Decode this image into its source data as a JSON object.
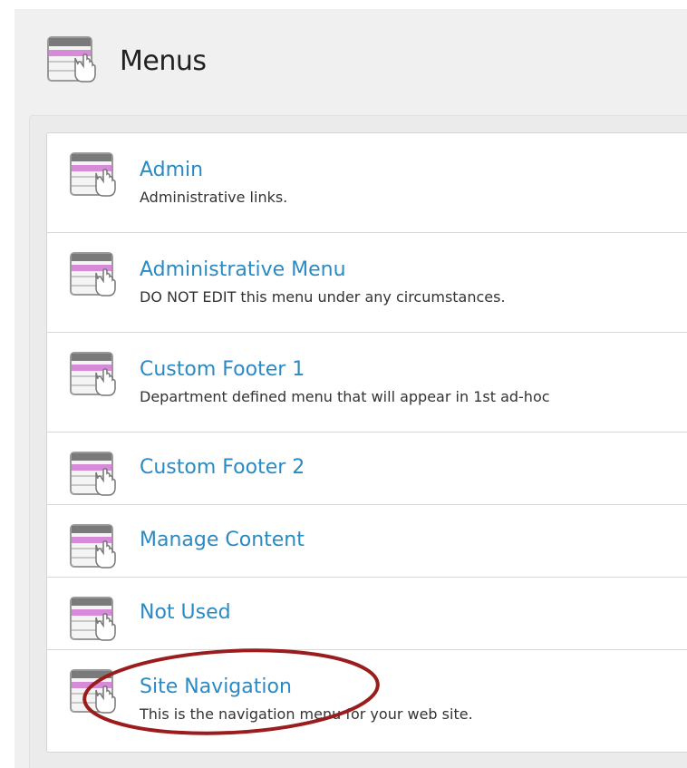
{
  "header": {
    "title": "Menus",
    "icon": "menu-icon"
  },
  "menus": [
    {
      "name": "Admin",
      "description": "Administrative links.",
      "icon": "menu-icon"
    },
    {
      "name": "Administrative Menu",
      "description": "DO NOT EDIT this menu under any circumstances.",
      "icon": "menu-icon"
    },
    {
      "name": "Custom Footer 1",
      "description": "Department defined menu that will appear in 1st ad-hoc",
      "icon": "menu-icon"
    },
    {
      "name": "Custom Footer 2",
      "description": "",
      "icon": "menu-icon"
    },
    {
      "name": "Manage Content",
      "description": "",
      "icon": "menu-icon"
    },
    {
      "name": "Not Used",
      "description": "",
      "icon": "menu-icon"
    },
    {
      "name": "Site Navigation",
      "description": "This is the navigation menu for your web site.",
      "icon": "menu-icon"
    }
  ],
  "colors": {
    "link": "#2a8ac4",
    "highlight_ellipse": "#9b1c1c",
    "icon_accent": "#d68ad8"
  }
}
